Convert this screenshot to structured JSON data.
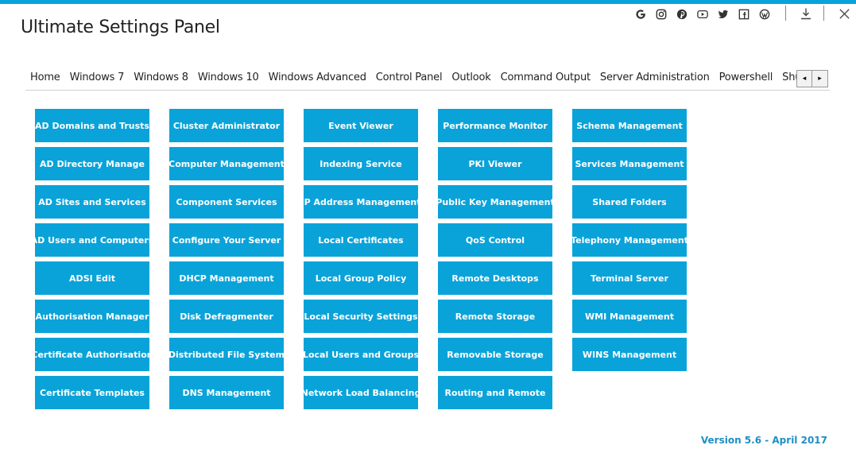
{
  "app": {
    "title": "Ultimate Settings Panel"
  },
  "social_icons": [
    "google-icon",
    "instagram-icon",
    "pinterest-icon",
    "youtube-icon",
    "twitter-icon",
    "facebook-icon",
    "wordpress-icon"
  ],
  "tabs": [
    {
      "label": "Home"
    },
    {
      "label": "Windows 7"
    },
    {
      "label": "Windows 8"
    },
    {
      "label": "Windows 10"
    },
    {
      "label": "Windows Advanced"
    },
    {
      "label": "Control Panel"
    },
    {
      "label": "Outlook"
    },
    {
      "label": "Command Output"
    },
    {
      "label": "Server Administration",
      "active": true
    },
    {
      "label": "Powershell"
    },
    {
      "label": "Shutdown C"
    }
  ],
  "scroll": {
    "left": "◂",
    "right": "▸"
  },
  "tiles": [
    [
      "AD Domains and Trusts",
      "AD Directory Manage",
      "AD Sites and Services",
      "AD Users and Computers",
      "ADSI Edit",
      "Authorisation Manager",
      "Certificate Authorisation",
      "Certificate Templates"
    ],
    [
      "Cluster Administrator",
      "Computer Management",
      "Component Services",
      "Configure Your Server",
      "DHCP Management",
      "Disk Defragmenter",
      "Distributed File System",
      "DNS Management"
    ],
    [
      "Event Viewer",
      "Indexing Service",
      "IP Address Management",
      "Local Certificates",
      "Local Group Policy",
      "Local Security Settings",
      "Local Users and Groups",
      "Network Load Balancing"
    ],
    [
      "Performance Monitor",
      "PKI Viewer",
      "Public Key Management",
      "QoS Control",
      "Remote Desktops",
      "Remote Storage",
      "Removable Storage",
      "Routing and Remote"
    ],
    [
      "Schema Management",
      "Services Management",
      "Shared Folders",
      "Telephony Management",
      "Terminal Server",
      "WMI Management",
      "WINS Management"
    ]
  ],
  "version": "Version 5.6 - April 2017",
  "colors": {
    "accent": "#0aa3d9",
    "version_text": "#1f8fc4"
  }
}
